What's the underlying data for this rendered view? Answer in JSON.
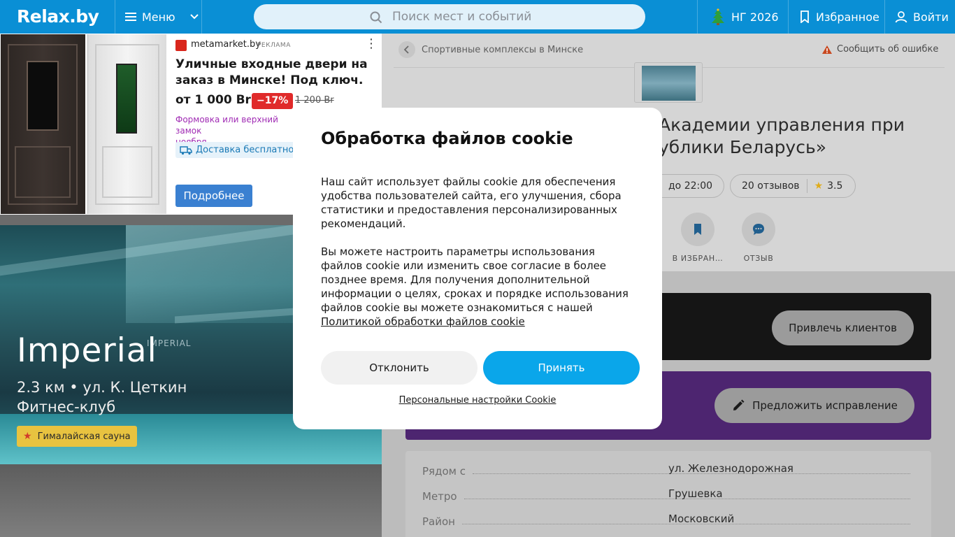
{
  "header": {
    "logo": "Relax.by",
    "menu_label": "Меню",
    "search_placeholder": "Поиск мест и событий",
    "ny_label": "НГ 2026",
    "favorites_label": "Избранное",
    "login_label": "Войти"
  },
  "ad": {
    "brand": "metamarket.by",
    "tag": "РЕКЛАМА",
    "title": "Уличные входные двери на заказ в Минске! Под ключ.",
    "price": "от 1 000 Br",
    "discount": "−17%",
    "old_price": "1 200 Br",
    "promo_text": "Формовка или верхний замок\nноября",
    "delivery": "Доставка бесплатно",
    "more_button": "Подробнее"
  },
  "hero": {
    "title": "Imperial",
    "address": "2.3 км • ул. К. Цеткин",
    "type": "Фитнес-клуб",
    "badge": "Гималайская сауна",
    "sign": "IMPERIAL"
  },
  "page": {
    "breadcrumb": "Спортивные комплексы в Минске",
    "report": "Сообщить об ошибке",
    "title": "Академии управления при\nублики Беларусь»",
    "hours": "до 22:00",
    "reviews": "20 отзывов",
    "rating": "3.5",
    "actions": [
      {
        "label": "В ИЗБРАН…"
      },
      {
        "label": "ОТЗЫВ"
      }
    ],
    "attract_button": "Привлечь клиентов",
    "suggest_button": "Предложить исправление",
    "info": [
      {
        "key": "Рядом с",
        "value": "ул. Железнодорожная"
      },
      {
        "key": "Метро",
        "value": "Грушевка"
      },
      {
        "key": "Район",
        "value": "Московский"
      }
    ]
  },
  "cookie": {
    "title": "Обработка файлов cookie",
    "p1": "Наш сайт использует файлы cookie для обеспечения удобства пользователей сайта, его улучшения, сбора статистики и предоставления персонализированных рекомендаций.",
    "p2": "Вы можете настроить параметры использования файлов cookie или изменить свое согласие в более позднее время. Для получения дополнительной информации о целях, сроках и порядке использования файлов cookie вы можете ознакомиться с нашей",
    "policy_link": "Политикой обработки файлов cookie",
    "decline": "Отклонить",
    "accept": "Принять",
    "settings": "Персональные настройки Cookie"
  },
  "colors": {
    "header_bg": "#0a8fd5",
    "accept_bg": "#0aa6ea",
    "discount_bg": "#e02a2a",
    "badge_bg": "#e8c340"
  }
}
